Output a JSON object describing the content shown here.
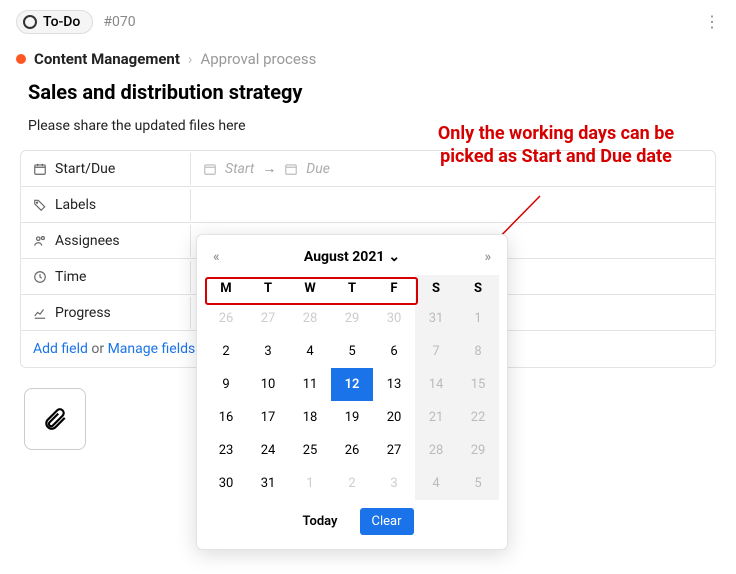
{
  "header": {
    "status_label": "To-Do",
    "task_id": "#070"
  },
  "breadcrumb": {
    "project": "Content Management",
    "sub": "Approval process"
  },
  "task": {
    "title": "Sales and distribution strategy",
    "description": "Please share the updated files here"
  },
  "fields": {
    "start_due": {
      "label": "Start/Due",
      "start_ph": "Start",
      "due_ph": "Due"
    },
    "labels": {
      "label": "Labels"
    },
    "assignees": {
      "label": "Assignees"
    },
    "time": {
      "label": "Time"
    },
    "progress": {
      "label": "Progress"
    }
  },
  "footer": {
    "add": "Add field",
    "or": " or ",
    "manage": "Manage fields"
  },
  "annotation": {
    "text": "Only the working  days can be picked as Start and Due date"
  },
  "datepicker": {
    "month_label": "August 2021",
    "dow": [
      "M",
      "T",
      "W",
      "T",
      "F",
      "S",
      "S"
    ],
    "today_label": "Today",
    "clear_label": "Clear",
    "selected": "12",
    "weeks": [
      [
        {
          "d": "26",
          "other": true
        },
        {
          "d": "27",
          "other": true
        },
        {
          "d": "28",
          "other": true
        },
        {
          "d": "29",
          "other": true
        },
        {
          "d": "30",
          "other": true
        },
        {
          "d": "31",
          "wk": true,
          "other": true
        },
        {
          "d": "1",
          "wk": true
        }
      ],
      [
        {
          "d": "2"
        },
        {
          "d": "3"
        },
        {
          "d": "4"
        },
        {
          "d": "5"
        },
        {
          "d": "6"
        },
        {
          "d": "7",
          "wk": true
        },
        {
          "d": "8",
          "wk": true
        }
      ],
      [
        {
          "d": "9"
        },
        {
          "d": "10"
        },
        {
          "d": "11"
        },
        {
          "d": "12",
          "sel": true
        },
        {
          "d": "13"
        },
        {
          "d": "14",
          "wk": true
        },
        {
          "d": "15",
          "wk": true
        }
      ],
      [
        {
          "d": "16"
        },
        {
          "d": "17"
        },
        {
          "d": "18"
        },
        {
          "d": "19"
        },
        {
          "d": "20"
        },
        {
          "d": "21",
          "wk": true
        },
        {
          "d": "22",
          "wk": true
        }
      ],
      [
        {
          "d": "23"
        },
        {
          "d": "24"
        },
        {
          "d": "25"
        },
        {
          "d": "26"
        },
        {
          "d": "27"
        },
        {
          "d": "28",
          "wk": true
        },
        {
          "d": "29",
          "wk": true
        }
      ],
      [
        {
          "d": "30"
        },
        {
          "d": "31"
        },
        {
          "d": "1",
          "other": true
        },
        {
          "d": "2",
          "other": true
        },
        {
          "d": "3",
          "other": true
        },
        {
          "d": "4",
          "wk": true,
          "other": true
        },
        {
          "d": "5",
          "wk": true,
          "other": true
        }
      ]
    ]
  }
}
